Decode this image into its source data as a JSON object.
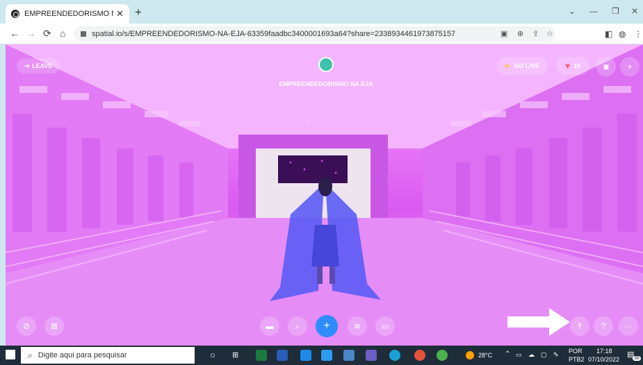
{
  "browser": {
    "tab_title": "EMPREENDEDORISMO NA EJA | ",
    "tab_close": "✕",
    "new_tab": "+",
    "url": "spatial.io/s/EMPREENDEDORISMO-NA-EJA-63359faadbc3400001693a64?share=2338934461973875157",
    "window_minimize": "—",
    "window_restore": "❐",
    "window_close": "✕",
    "window_menu": "⌄"
  },
  "space": {
    "leave_label": "LEAVE",
    "space_name": "EMPREENDEDORISMO NA EJA",
    "gallery_sign": "GALLERY",
    "go_live_label": "GO LIVE",
    "likes_count": "10"
  },
  "taskbar": {
    "search_placeholder": "Digite aqui para pesquisar",
    "weather": "28°C",
    "language_line1": "POR",
    "language_line2": "PTB2",
    "time": "17:18",
    "date": "07/10/2022",
    "notification_badge": "38"
  },
  "colors": {
    "scene_accent": "#d95af0",
    "primary_button": "#2f8cff",
    "heart": "#ff5a7a",
    "avatar": "#5b5cf5"
  }
}
